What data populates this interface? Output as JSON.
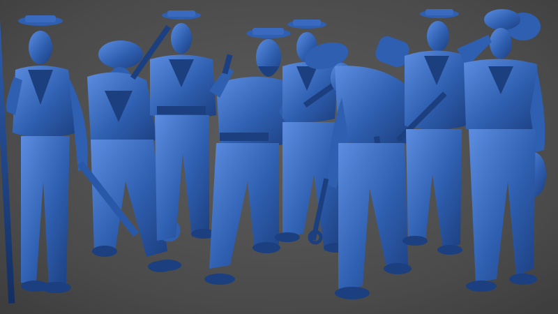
{
  "viewport": {
    "background_colors": [
      "#5d5d5d",
      "#4a4a4a",
      "#3c3c3c"
    ],
    "description_visible": false
  },
  "figures": {
    "material_colors": {
      "base": "#2f5fb0",
      "light": "#5d8de0",
      "dark": "#1c3f80",
      "shadow": "#142e60"
    },
    "count": 8,
    "items": [
      {
        "role": "sailor-with-flagpole",
        "pose": "standing"
      },
      {
        "role": "sailor-with-wrench",
        "pose": "bending"
      },
      {
        "role": "sailor-with-rifle-on-shoulder",
        "pose": "standing"
      },
      {
        "role": "bearded-sailor-with-pistol",
        "pose": "crouching"
      },
      {
        "role": "sailor-with-sledgehammer",
        "pose": "standing"
      },
      {
        "role": "sailor-with-crowbar",
        "pose": "bending"
      },
      {
        "role": "old-sailor-with-hammer",
        "pose": "standing"
      },
      {
        "role": "sailor-shading-eyes-with-sack",
        "pose": "standing"
      }
    ]
  }
}
